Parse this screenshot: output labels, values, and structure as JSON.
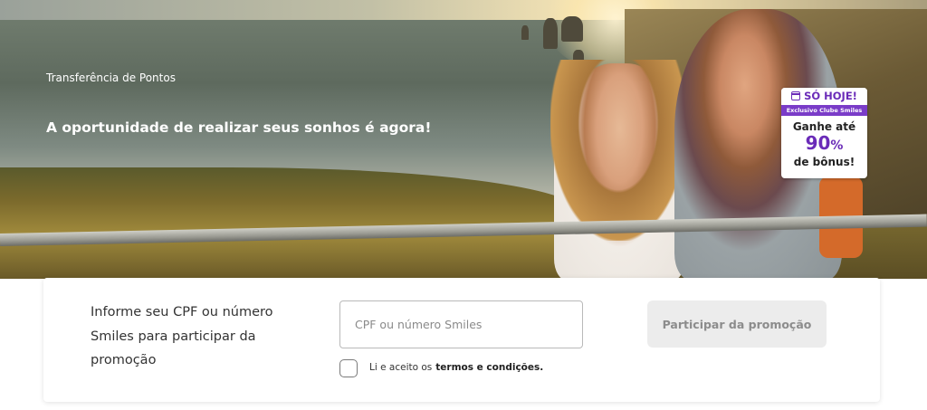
{
  "hero": {
    "subtitle": "Transferência de Pontos",
    "title": "A oportunidade de realizar seus sonhos é agora!"
  },
  "badge": {
    "icon": "calendar-icon",
    "top_label": "SÓ HOJE!",
    "strip_label": "Exclusivo Clube Smiles",
    "line1": "Ganhe até",
    "percent_value": "90",
    "percent_sign": "%",
    "line3": "de bônus!",
    "accent_color": "#6a2bb8"
  },
  "form": {
    "info_text": "Informe seu CPF ou número Smiles para participar da promoção",
    "cpf_placeholder": "CPF ou número Smiles",
    "terms_prefix": "Li e aceito os",
    "terms_link": "termos e condições.",
    "submit_label": "Participar da promoção"
  }
}
